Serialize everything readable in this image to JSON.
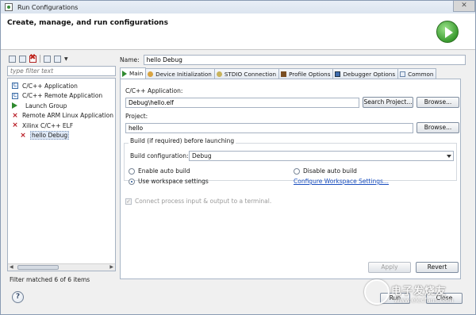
{
  "window": {
    "title": "Run Configurations",
    "close_label": "✕"
  },
  "banner": {
    "title": "Create, manage, and run configurations"
  },
  "left": {
    "filter_placeholder": "type filter text",
    "tree": [
      {
        "label": "C/C++ Application",
        "icon": "c-app-icon"
      },
      {
        "label": "C/C++ Remote Application",
        "icon": "c-remote-icon"
      },
      {
        "label": "Launch Group",
        "icon": "launch-group-icon"
      },
      {
        "label": "Remote ARM Linux Application",
        "icon": "xilinx-icon"
      },
      {
        "label": "Xilinx C/C++ ELF",
        "icon": "xilinx-icon"
      },
      {
        "label": "hello Debug",
        "icon": "xilinx-icon",
        "selected": true
      }
    ],
    "status": "Filter matched 6 of 6 items"
  },
  "right": {
    "name_label": "Name:",
    "name_value": "hello Debug",
    "tabs": [
      {
        "label": "Main",
        "icon": "main-tab-icon"
      },
      {
        "label": "Device Initialization",
        "icon": "device-init-icon"
      },
      {
        "label": "STDIO Connection",
        "icon": "stdio-icon"
      },
      {
        "label": "Profile Options",
        "icon": "profile-icon"
      },
      {
        "label": "Debugger Options",
        "icon": "debugger-icon"
      },
      {
        "label": "Common",
        "icon": "common-icon"
      }
    ],
    "main": {
      "app_label": "C/C++ Application:",
      "app_value": "Debug\\hello.elf",
      "search_project": "Search Project...",
      "browse1": "Browse...",
      "project_label": "Project:",
      "project_value": "hello",
      "browse2": "Browse...",
      "build_label": "Build (if required) before launching",
      "build_config_label": "Build configuration:",
      "build_config_value": "Debug",
      "enable_auto_build": "Enable auto build",
      "disable_auto_build": "Disable auto build",
      "use_workspace": "Use workspace settings",
      "configure_link": "Configure Workspace Settings...",
      "connect_process": "Connect process input & output to a terminal."
    },
    "apply": "Apply",
    "revert": "Revert"
  },
  "footer": {
    "run": "Run",
    "close": "Close"
  },
  "watermark": {
    "text": "电子发烧友",
    "url": "www.elecfans.com"
  }
}
